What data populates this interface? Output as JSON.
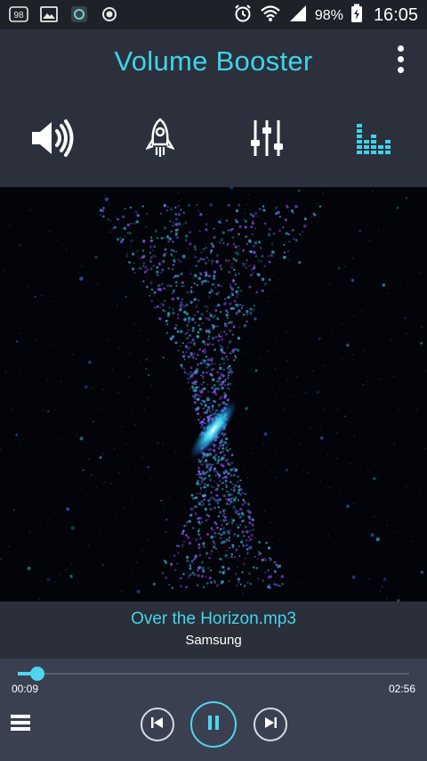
{
  "status_bar": {
    "notification_badge": "98",
    "battery_percent": "98%",
    "time": "16:05",
    "icons": [
      "notification-icon",
      "gallery-icon",
      "app-icon",
      "record-icon",
      "alarm-icon",
      "wifi-icon",
      "signal-icon",
      "battery-icon"
    ]
  },
  "header": {
    "title": "Volume Booster"
  },
  "tabs": [
    {
      "id": "volume",
      "icon": "speaker-icon",
      "active": false
    },
    {
      "id": "boost",
      "icon": "rocket-icon",
      "active": false
    },
    {
      "id": "equalizer",
      "icon": "sliders-icon",
      "active": false
    },
    {
      "id": "visualizer",
      "icon": "bars-icon",
      "active": true
    }
  ],
  "now_playing": {
    "title": "Over the Horizon.mp3",
    "artist": "Samsung"
  },
  "player": {
    "current_time": "00:09",
    "duration": "02:56",
    "progress_fraction": 0.05,
    "state": "playing"
  },
  "colors": {
    "accent": "#3ed3ea",
    "header_bg": "#2c303c",
    "controls_bg": "#3a4050"
  }
}
